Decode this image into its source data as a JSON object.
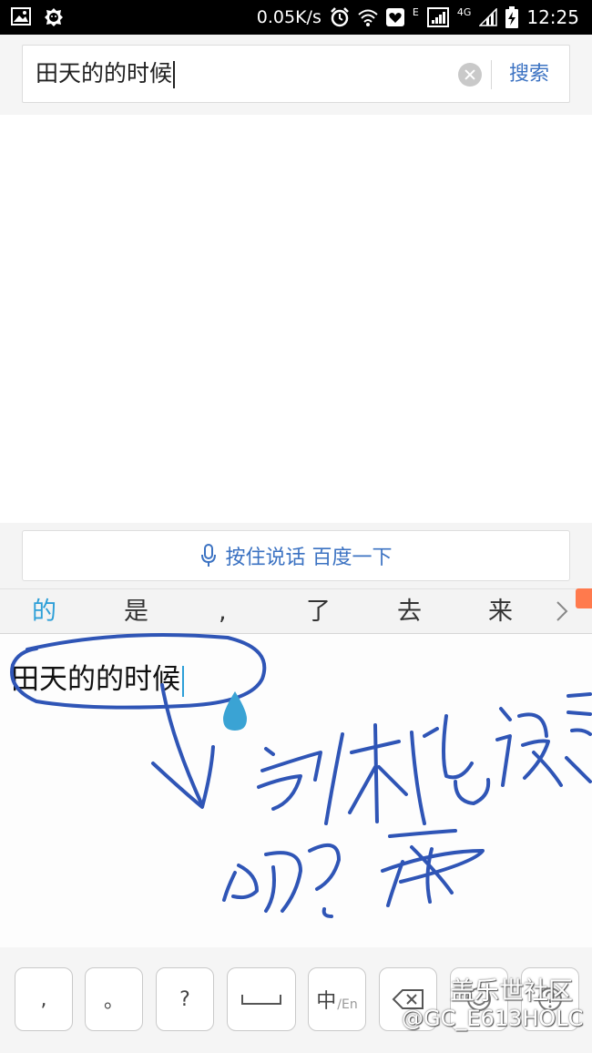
{
  "status_bar": {
    "speed": "0.05K/s",
    "net_e": "E",
    "net_4g": "4G",
    "time": "12:25"
  },
  "search": {
    "query": "田天的的时候",
    "button_label": "搜索"
  },
  "voice": {
    "label": "按住说话 百度一下"
  },
  "candidates": [
    "的",
    "是",
    ",",
    "了",
    "去",
    "来"
  ],
  "handwriting": {
    "recognized_text": "田天的的时候"
  },
  "keyboard": {
    "comma": ",",
    "period": "。",
    "question": "?",
    "lang_main": "中",
    "lang_sub": "/En"
  },
  "watermark": {
    "site": "盖乐世社区",
    "user": "@GC_E613HOLC"
  },
  "colors": {
    "accent": "#3b72c2",
    "candidate_active": "#2d9fd8",
    "ink": "#2f55b6"
  }
}
